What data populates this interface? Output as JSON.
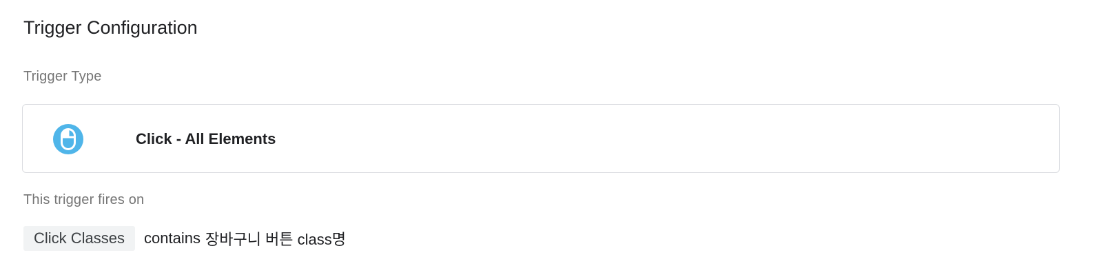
{
  "trigger_configuration": {
    "title": "Trigger Configuration",
    "trigger_type_label": "Trigger Type",
    "trigger_type": {
      "name": "Click - All Elements",
      "icon": "mouse-icon",
      "icon_color": "#4fb5e9"
    },
    "fires_on_label": "This trigger fires on",
    "condition": {
      "variable": "Click Classes",
      "operator": "contains",
      "value": "장바구니 버튼 class명"
    }
  }
}
